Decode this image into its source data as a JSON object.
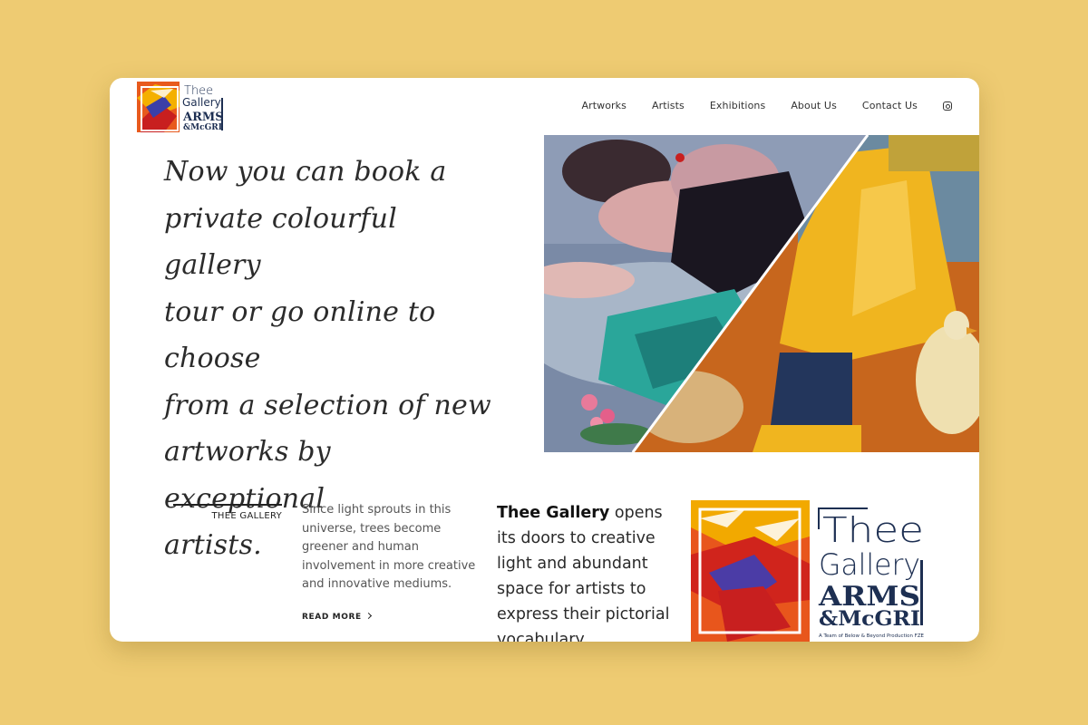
{
  "nav": {
    "items": [
      "Artworks",
      "Artists",
      "Exhibitions",
      "About Us",
      "Contact Us"
    ],
    "social_icon": "instagram-icon"
  },
  "logo": {
    "line1": "Thee",
    "line2": "Gallery",
    "line3": "ARMS",
    "line4": "&McGRI"
  },
  "hero": {
    "headline": "Now you can book a\nprivate colourful gallery\ntour or go online to choose\nfrom a selection of new\nartworks by exceptional\nartists."
  },
  "about": {
    "section_label": "THEE GALLERY",
    "intro": "Since light sprouts in this universe, trees become greener and human involvement in more creative and innovative mediums.",
    "read_more": "READ MORE",
    "statement_brand": "Thee Gallery",
    "statement_rest": " opens its doors to creative light and abundant space for artists to express their pictorial vocabulary."
  },
  "logo_large": {
    "line1": "Thee",
    "line2": "Gallery",
    "line3": "ARMS",
    "line4": "&McGRI",
    "tagline": "A Team of Below & Beyond Production FZE"
  },
  "colors": {
    "background": "#eecb72",
    "window": "#ffffff",
    "navy": "#1d2f52",
    "text": "#2b2b2b"
  }
}
